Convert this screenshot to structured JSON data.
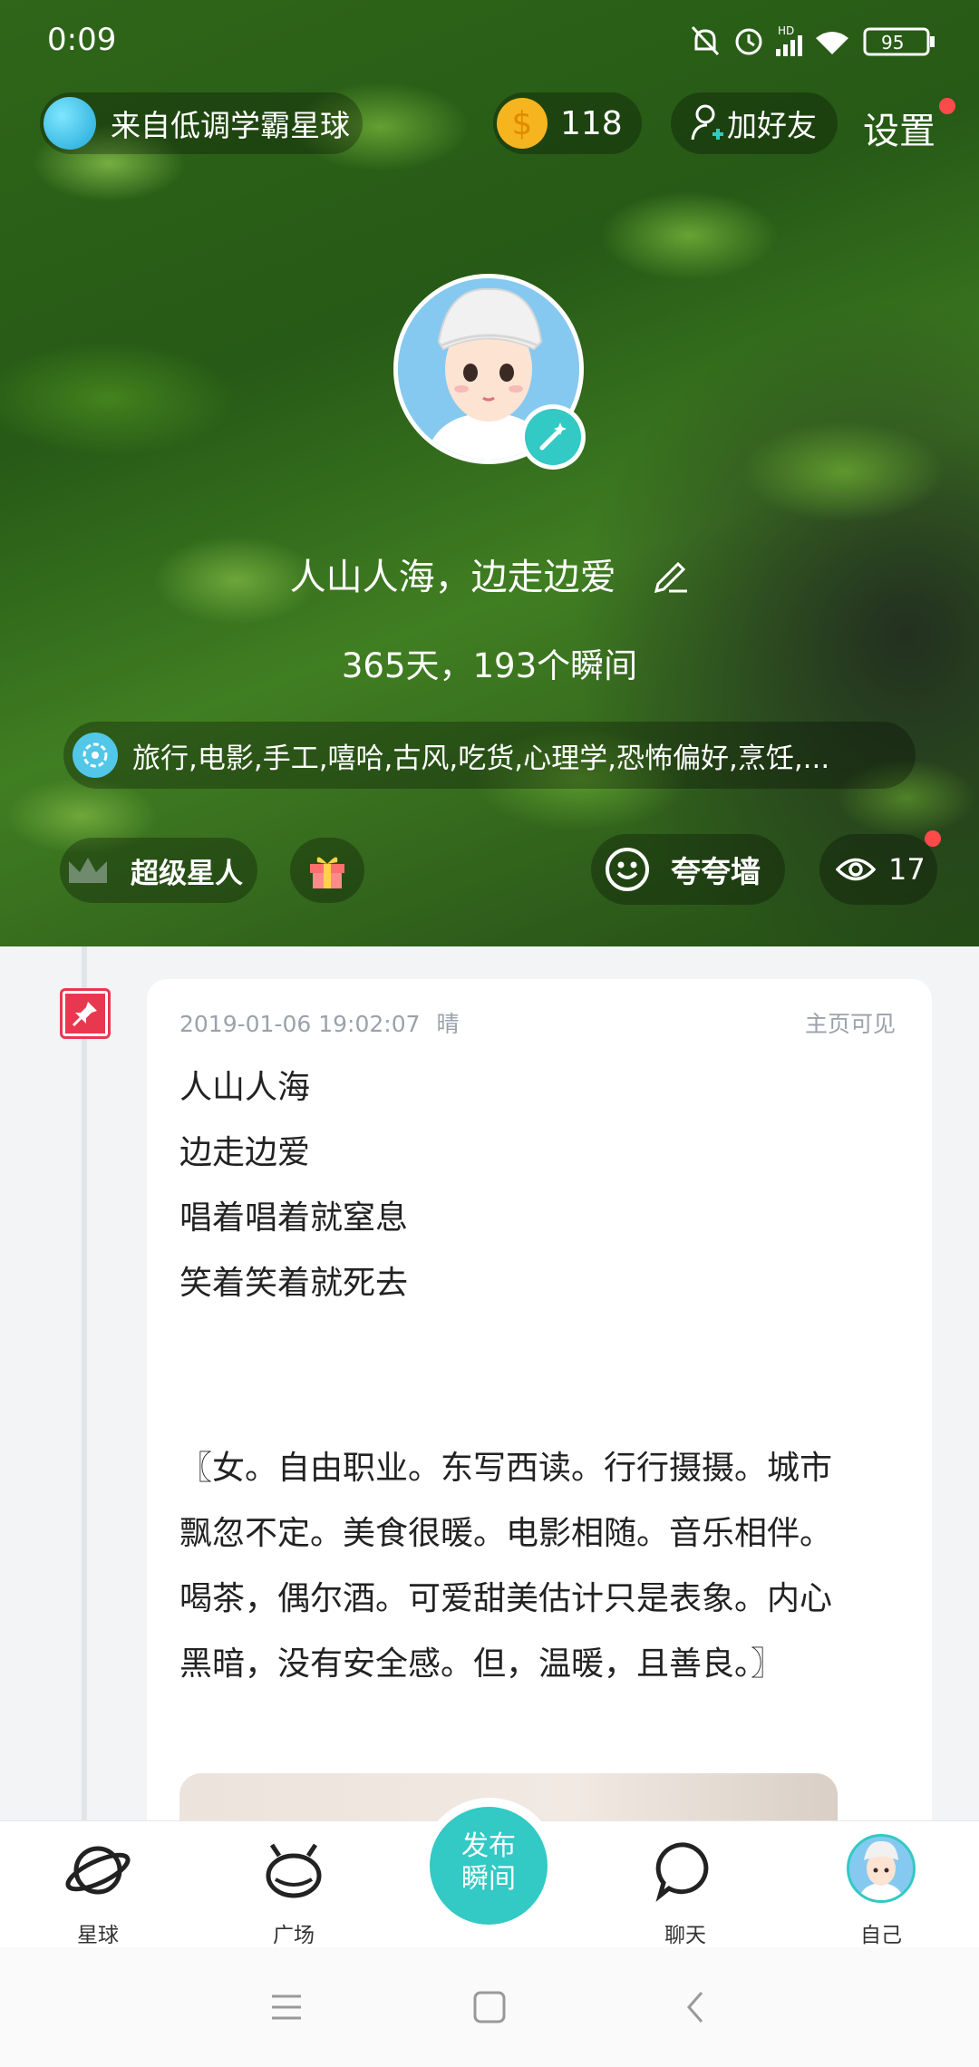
{
  "status_bar": {
    "time": "0:09",
    "battery": "95",
    "hd": "HD"
  },
  "top_bar": {
    "planet_label": "来自低调学霸星球",
    "coins": "118",
    "add_friend": "加好友",
    "settings": "设置"
  },
  "profile": {
    "nickname": "人山人海，边走边爱",
    "stats": "365天，193个瞬间",
    "tags": "旅行,电影,手工,嘻哈,古风,吃货,心理学,恐怖偏好,烹饪,..."
  },
  "badges": {
    "super_star": "超级星人",
    "praise_wall": "夸夸墙",
    "view_count": "17"
  },
  "post": {
    "datetime": "2019-01-06 19:02:07",
    "weather": "晴",
    "visibility": "主页可见",
    "lines": [
      "人山人海",
      "边走边爱",
      "唱着唱着就窒息",
      "笑着笑着就死去"
    ],
    "paragraph_lines": [
      "〖女。自由职业。东写西读。行行摄摄。城市",
      "飘忽不定。美食很暖。电影相随。音乐相伴。",
      "喝茶，偶尔酒。可爱甜美估计只是表象。内心",
      "黑暗，没有安全感。但，温暖，且善良。〗"
    ]
  },
  "bottom_nav": {
    "planet": "星球",
    "square": "广场",
    "publish_line1": "发布",
    "publish_line2": "瞬间",
    "chat": "聊天",
    "me": "自己"
  },
  "colors": {
    "accent": "#33c9c4",
    "pin_red": "#e8384f",
    "coin_gold": "#f6b51e",
    "notify_red": "#ff4a4a"
  }
}
